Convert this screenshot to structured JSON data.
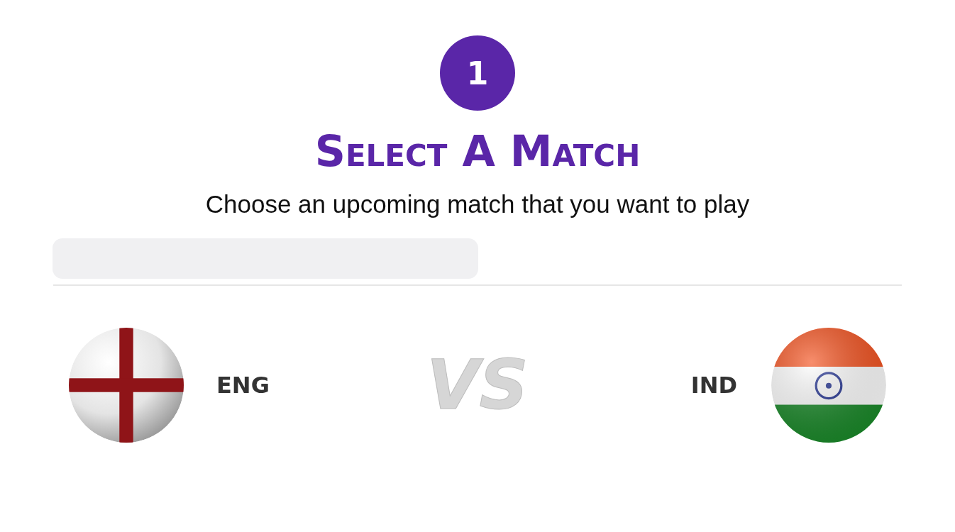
{
  "step": {
    "number": "1"
  },
  "title": "Select A Match",
  "subtitle": "Choose an upcoming match that you want to play",
  "match": {
    "home": {
      "code": "ENG",
      "kind": "england"
    },
    "vs_label": "VS",
    "away": {
      "code": "IND",
      "kind": "india"
    }
  }
}
